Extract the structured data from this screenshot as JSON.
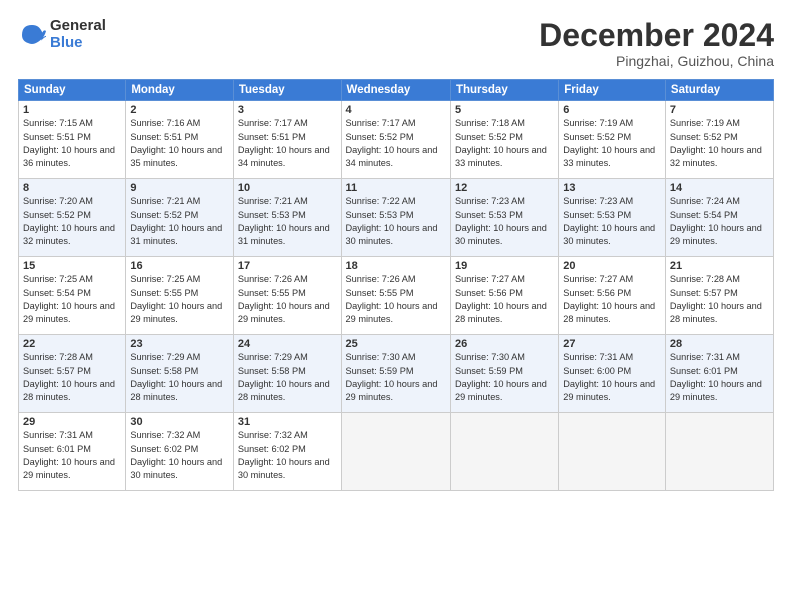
{
  "logo": {
    "general": "General",
    "blue": "Blue"
  },
  "title": "December 2024",
  "subtitle": "Pingzhai, Guizhou, China",
  "weekdays": [
    "Sunday",
    "Monday",
    "Tuesday",
    "Wednesday",
    "Thursday",
    "Friday",
    "Saturday"
  ],
  "weeks": [
    [
      {
        "day": "1",
        "sunrise": "7:15 AM",
        "sunset": "5:51 PM",
        "daylight": "10 hours and 36 minutes."
      },
      {
        "day": "2",
        "sunrise": "7:16 AM",
        "sunset": "5:51 PM",
        "daylight": "10 hours and 35 minutes."
      },
      {
        "day": "3",
        "sunrise": "7:17 AM",
        "sunset": "5:51 PM",
        "daylight": "10 hours and 34 minutes."
      },
      {
        "day": "4",
        "sunrise": "7:17 AM",
        "sunset": "5:52 PM",
        "daylight": "10 hours and 34 minutes."
      },
      {
        "day": "5",
        "sunrise": "7:18 AM",
        "sunset": "5:52 PM",
        "daylight": "10 hours and 33 minutes."
      },
      {
        "day": "6",
        "sunrise": "7:19 AM",
        "sunset": "5:52 PM",
        "daylight": "10 hours and 33 minutes."
      },
      {
        "day": "7",
        "sunrise": "7:19 AM",
        "sunset": "5:52 PM",
        "daylight": "10 hours and 32 minutes."
      }
    ],
    [
      {
        "day": "8",
        "sunrise": "7:20 AM",
        "sunset": "5:52 PM",
        "daylight": "10 hours and 32 minutes."
      },
      {
        "day": "9",
        "sunrise": "7:21 AM",
        "sunset": "5:52 PM",
        "daylight": "10 hours and 31 minutes."
      },
      {
        "day": "10",
        "sunrise": "7:21 AM",
        "sunset": "5:53 PM",
        "daylight": "10 hours and 31 minutes."
      },
      {
        "day": "11",
        "sunrise": "7:22 AM",
        "sunset": "5:53 PM",
        "daylight": "10 hours and 30 minutes."
      },
      {
        "day": "12",
        "sunrise": "7:23 AM",
        "sunset": "5:53 PM",
        "daylight": "10 hours and 30 minutes."
      },
      {
        "day": "13",
        "sunrise": "7:23 AM",
        "sunset": "5:53 PM",
        "daylight": "10 hours and 30 minutes."
      },
      {
        "day": "14",
        "sunrise": "7:24 AM",
        "sunset": "5:54 PM",
        "daylight": "10 hours and 29 minutes."
      }
    ],
    [
      {
        "day": "15",
        "sunrise": "7:25 AM",
        "sunset": "5:54 PM",
        "daylight": "10 hours and 29 minutes."
      },
      {
        "day": "16",
        "sunrise": "7:25 AM",
        "sunset": "5:55 PM",
        "daylight": "10 hours and 29 minutes."
      },
      {
        "day": "17",
        "sunrise": "7:26 AM",
        "sunset": "5:55 PM",
        "daylight": "10 hours and 29 minutes."
      },
      {
        "day": "18",
        "sunrise": "7:26 AM",
        "sunset": "5:55 PM",
        "daylight": "10 hours and 29 minutes."
      },
      {
        "day": "19",
        "sunrise": "7:27 AM",
        "sunset": "5:56 PM",
        "daylight": "10 hours and 28 minutes."
      },
      {
        "day": "20",
        "sunrise": "7:27 AM",
        "sunset": "5:56 PM",
        "daylight": "10 hours and 28 minutes."
      },
      {
        "day": "21",
        "sunrise": "7:28 AM",
        "sunset": "5:57 PM",
        "daylight": "10 hours and 28 minutes."
      }
    ],
    [
      {
        "day": "22",
        "sunrise": "7:28 AM",
        "sunset": "5:57 PM",
        "daylight": "10 hours and 28 minutes."
      },
      {
        "day": "23",
        "sunrise": "7:29 AM",
        "sunset": "5:58 PM",
        "daylight": "10 hours and 28 minutes."
      },
      {
        "day": "24",
        "sunrise": "7:29 AM",
        "sunset": "5:58 PM",
        "daylight": "10 hours and 28 minutes."
      },
      {
        "day": "25",
        "sunrise": "7:30 AM",
        "sunset": "5:59 PM",
        "daylight": "10 hours and 29 minutes."
      },
      {
        "day": "26",
        "sunrise": "7:30 AM",
        "sunset": "5:59 PM",
        "daylight": "10 hours and 29 minutes."
      },
      {
        "day": "27",
        "sunrise": "7:31 AM",
        "sunset": "6:00 PM",
        "daylight": "10 hours and 29 minutes."
      },
      {
        "day": "28",
        "sunrise": "7:31 AM",
        "sunset": "6:01 PM",
        "daylight": "10 hours and 29 minutes."
      }
    ],
    [
      {
        "day": "29",
        "sunrise": "7:31 AM",
        "sunset": "6:01 PM",
        "daylight": "10 hours and 29 minutes."
      },
      {
        "day": "30",
        "sunrise": "7:32 AM",
        "sunset": "6:02 PM",
        "daylight": "10 hours and 30 minutes."
      },
      {
        "day": "31",
        "sunrise": "7:32 AM",
        "sunset": "6:02 PM",
        "daylight": "10 hours and 30 minutes."
      },
      null,
      null,
      null,
      null
    ]
  ]
}
